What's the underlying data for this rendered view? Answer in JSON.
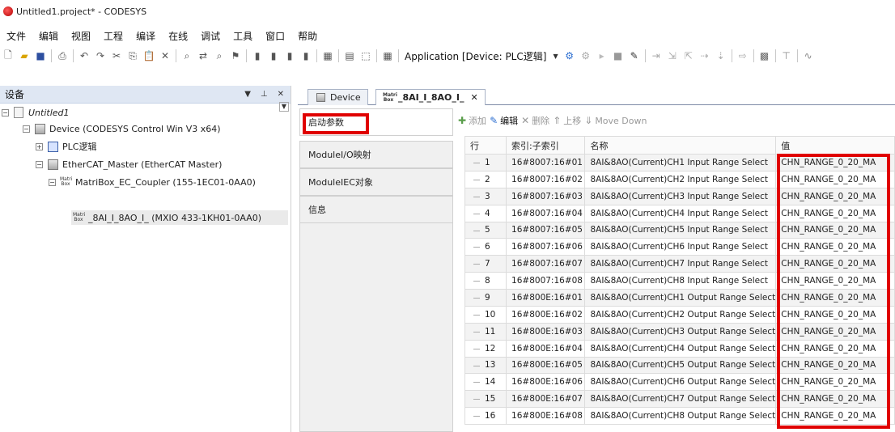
{
  "window": {
    "title": "Untitled1.project* - CODESYS"
  },
  "menu": [
    "文件",
    "编辑",
    "视图",
    "工程",
    "编译",
    "在线",
    "调试",
    "工具",
    "窗口",
    "帮助"
  ],
  "toolbar": {
    "application_label": "Application [Device: PLC逻辑]"
  },
  "device_pane": {
    "title": "设备",
    "tree": [
      {
        "label": "Untitled1"
      },
      {
        "label": "Device (CODESYS Control Win V3 x64)"
      },
      {
        "label": "PLC逻辑"
      },
      {
        "label": "EtherCAT_Master (EtherCAT Master)"
      },
      {
        "label": "MatriBox_EC_Coupler (155-1EC01-0AA0)"
      },
      {
        "label": "_8AI_I_8AO_I_ (MXIO 433-1KH01-0AA0)"
      }
    ]
  },
  "editor": {
    "tabs": [
      {
        "label": "Device"
      },
      {
        "label": "_8AI_I_8AO_I_"
      }
    ],
    "side_tabs": [
      {
        "label": "启动参数"
      },
      {
        "label": "ModuleI/O映射"
      },
      {
        "label": "ModuleIEC对象"
      },
      {
        "label": "信息"
      }
    ],
    "actions": [
      {
        "label": "添加",
        "icon": "plus-icon"
      },
      {
        "label": "编辑",
        "icon": "edit-icon"
      },
      {
        "label": "删除",
        "icon": "delete-icon"
      },
      {
        "label": "上移",
        "icon": "arrow-up-icon"
      },
      {
        "label": "Move Down",
        "icon": "arrow-down-icon"
      }
    ],
    "table": {
      "headers": [
        "行",
        "索引:子索引",
        "名称",
        "值"
      ],
      "rows": [
        {
          "row": "1",
          "index": "16#8007:16#01",
          "name": "8AI&8AO(Current)CH1 Input Range Select",
          "value": "CHN_RANGE_0_20_MA"
        },
        {
          "row": "2",
          "index": "16#8007:16#02",
          "name": "8AI&8AO(Current)CH2 Input Range Select",
          "value": "CHN_RANGE_0_20_MA"
        },
        {
          "row": "3",
          "index": "16#8007:16#03",
          "name": "8AI&8AO(Current)CH3 Input Range Select",
          "value": "CHN_RANGE_0_20_MA"
        },
        {
          "row": "4",
          "index": "16#8007:16#04",
          "name": "8AI&8AO(Current)CH4 Input Range Select",
          "value": "CHN_RANGE_0_20_MA"
        },
        {
          "row": "5",
          "index": "16#8007:16#05",
          "name": "8AI&8AO(Current)CH5 Input Range Select",
          "value": "CHN_RANGE_0_20_MA"
        },
        {
          "row": "6",
          "index": "16#8007:16#06",
          "name": "8AI&8AO(Current)CH6 Input Range Select",
          "value": "CHN_RANGE_0_20_MA"
        },
        {
          "row": "7",
          "index": "16#8007:16#07",
          "name": "8AI&8AO(Current)CH7 Input Range Select",
          "value": "CHN_RANGE_0_20_MA"
        },
        {
          "row": "8",
          "index": "16#8007:16#08",
          "name": "8AI&8AO(Current)CH8 Input Range Select",
          "value": "CHN_RANGE_0_20_MA"
        },
        {
          "row": "9",
          "index": "16#800E:16#01",
          "name": "8AI&8AO(Current)CH1 Output Range Select",
          "value": "CHN_RANGE_0_20_MA"
        },
        {
          "row": "10",
          "index": "16#800E:16#02",
          "name": "8AI&8AO(Current)CH2 Output Range Select",
          "value": "CHN_RANGE_0_20_MA"
        },
        {
          "row": "11",
          "index": "16#800E:16#03",
          "name": "8AI&8AO(Current)CH3 Output Range Select",
          "value": "CHN_RANGE_0_20_MA"
        },
        {
          "row": "12",
          "index": "16#800E:16#04",
          "name": "8AI&8AO(Current)CH4 Output Range Select",
          "value": "CHN_RANGE_0_20_MA"
        },
        {
          "row": "13",
          "index": "16#800E:16#05",
          "name": "8AI&8AO(Current)CH5 Output Range Select",
          "value": "CHN_RANGE_0_20_MA"
        },
        {
          "row": "14",
          "index": "16#800E:16#06",
          "name": "8AI&8AO(Current)CH6 Output Range Select",
          "value": "CHN_RANGE_0_20_MA"
        },
        {
          "row": "15",
          "index": "16#800E:16#07",
          "name": "8AI&8AO(Current)CH7 Output Range Select",
          "value": "CHN_RANGE_0_20_MA"
        },
        {
          "row": "16",
          "index": "16#800E:16#08",
          "name": "8AI&8AO(Current)CH8 Output Range Select",
          "value": "CHN_RANGE_0_20_MA"
        }
      ]
    }
  },
  "colors": {
    "highlight": "#e00000",
    "pane_header": "#dfe7f3"
  }
}
